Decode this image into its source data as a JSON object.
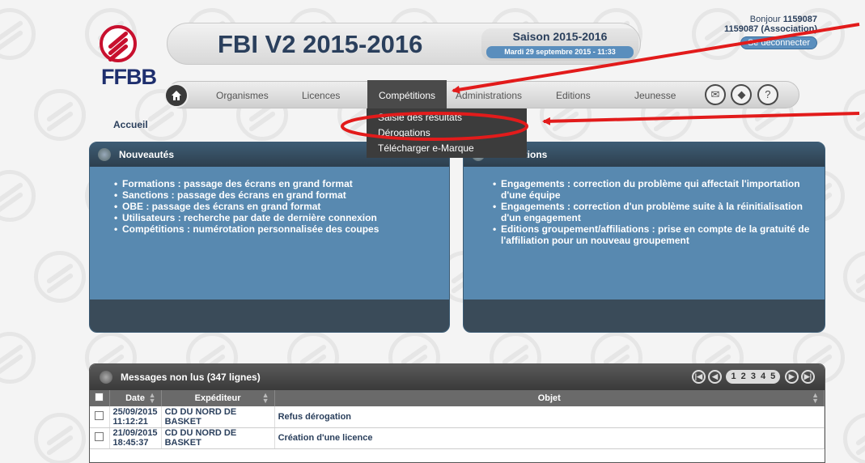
{
  "app": {
    "logo_text": "FFBB",
    "title": "FBI V2 2015-2016",
    "season_label": "Saison 2015-2016",
    "season_date": "Mardi 29 septembre 2015 - 11:33"
  },
  "user": {
    "greeting": "Bonjour",
    "user_id": "1159087",
    "account": "1159087 (Association)",
    "logout_label": "Se déconnecter"
  },
  "nav": {
    "items": [
      "Organismes",
      "Licences",
      "Compétitions",
      "Administrations",
      "Editions",
      "Jeunesse"
    ],
    "active": "Compétitions",
    "icons": [
      "mail-icon",
      "book-icon",
      "help-icon"
    ]
  },
  "dropdown": {
    "items": [
      "Saisie des résultats",
      "Dérogations",
      "Télécharger e-Marque"
    ]
  },
  "breadcrumb": "Accueil",
  "news_left": {
    "title": "Nouveautés",
    "items": [
      "Formations : passage des écrans en grand format",
      "Sanctions : passage des écrans en grand format",
      "OBE : passage des écrans en grand format",
      "Utilisateurs : recherche par date de dernière connexion",
      "Compétitions : numérotation personnalisée des coupes"
    ]
  },
  "news_right": {
    "title": "Corrections",
    "items": [
      "Engagements : correction du problème qui affectait l'importation d'une équipe",
      "Engagements : correction d'un problème suite à la réinitialisation d'un engagement",
      "Editions groupement/affiliations : prise en compte de la gratuité de l'affiliation pour un nouveau groupement"
    ]
  },
  "messages": {
    "title": "Messages non lus (347 lignes)",
    "pages": "1 2 3 4 5",
    "columns": [
      "Date",
      "Expéditeur",
      "Objet"
    ],
    "rows": [
      {
        "date": "25/09/2015",
        "time": "11:12:21",
        "sender": "CD DU NORD DE BASKET",
        "subject": "Refus dérogation"
      },
      {
        "date": "21/09/2015",
        "time": "18:45:37",
        "sender": "CD DU NORD DE BASKET",
        "subject": "Création d'une licence"
      }
    ]
  },
  "colors": {
    "accent_red": "#e21b1b",
    "panel_blue": "#5889b0",
    "nav_dark": "#4a4a4a"
  }
}
